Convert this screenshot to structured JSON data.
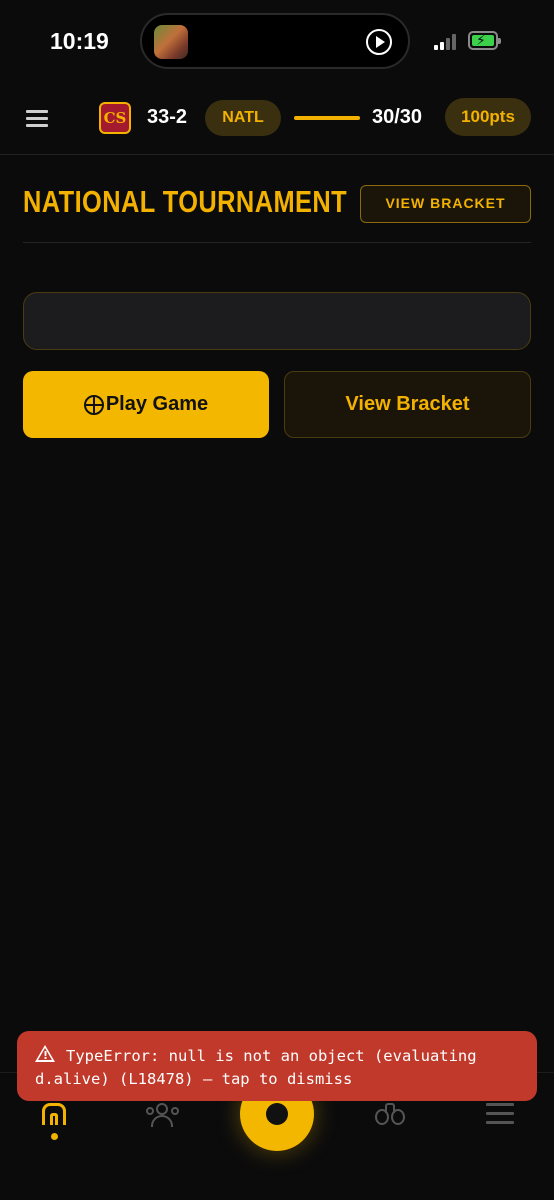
{
  "status_bar": {
    "time": "10:19",
    "icons": [
      "album-art-thumbnail",
      "play-icon",
      "signal-icon",
      "battery-charging-icon"
    ],
    "battery_color": "#3bd14b"
  },
  "header": {
    "team_logo_text": "CS",
    "record": "33-2",
    "stage_pill": "NATL",
    "progress": {
      "current": 30,
      "total": 30
    },
    "progress_label": "30/30",
    "points": "100pts"
  },
  "page": {
    "title": "NATIONAL TOURNAMENT",
    "view_bracket_label": "VIEW BRACKET"
  },
  "actions": {
    "play_label": "Play Game",
    "view_bracket_label": "View Bracket"
  },
  "toast": {
    "message": "TypeError: null is not an object (evaluating d.alive) (L18478) — tap to dismiss"
  },
  "bottom_nav": {
    "items": [
      "home-icon",
      "people-icon",
      "center-action-button",
      "binoculars-icon",
      "menu-icon"
    ],
    "active": "home-icon"
  },
  "colors": {
    "background": "#0b0b0c",
    "accent": "#f3b100",
    "accent_dark": "#3a3010",
    "toast": "#c0392b"
  }
}
